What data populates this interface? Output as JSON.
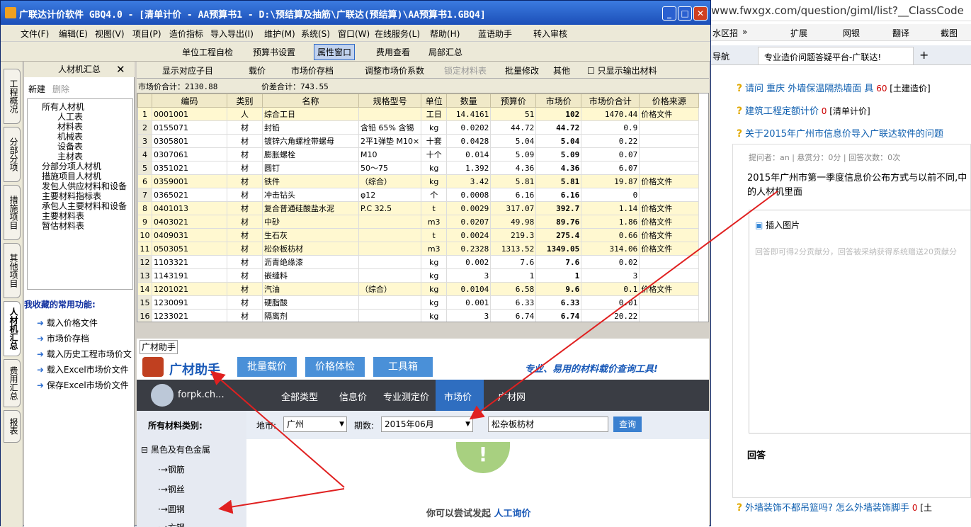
{
  "browser": {
    "url": "www.fwxgx.com/question/giml/list?__ClassCode",
    "tools": [
      "水区招",
      "»",
      "扩展",
      "网银",
      "翻译",
      "截图"
    ],
    "tabs": [
      "导航",
      "专业造价问题答疑平台-广联达!"
    ],
    "q1": "请问 重庆 外墙保温隔热墙面 具",
    "q1_pts": "60",
    "q1_tag": "[土建造价]",
    "q2": "建筑工程定额计价",
    "q2_pts": "0",
    "q2_tag": "[清单计价]",
    "q3": "关于2015年广州市信息价导入广联达软件的问题",
    "meta": "提问者：an  |  悬赏分：0分  |  回答次数：0次",
    "body": "2015年广州市第一季度信息价公布方式与以前不同,中的人材机里面",
    "insert_img": "插入图片",
    "placeholder": "回答即可得2分贡献分，回答被采纳获得系统赠送20贡献分",
    "answer": "回答",
    "q4": "外墙装饰不都吊篮吗? 怎么外墙装饰脚手",
    "q4_pts": "0",
    "q4_tag": "[土"
  },
  "title": "广联达计价软件 GBQ4.0 - [清单计价 - AA预算书1 - D:\\预结算及抽筋\\广联达(预结算)\\AA预算书1.GBQ4]",
  "menu": [
    "文件(F)",
    "编辑(E)",
    "视图(V)",
    "项目(P)",
    "造价指标",
    "导入导出(I)",
    "维护(M)",
    "系统(S)",
    "窗口(W)",
    "在线服务(L)",
    "帮助(H)",
    "蓝语助手",
    "转入审核"
  ],
  "toolbar": {
    "check": "单位工程自检",
    "setting": "预算书设置",
    "attr": "属性窗口",
    "fee": "费用查看",
    "local": "局部汇总"
  },
  "vtabs": [
    "工程概况",
    "分部分项",
    "措施项目",
    "其他项目",
    "人材机汇总",
    "费用汇总",
    "报表"
  ],
  "lpanel": {
    "title": "人材机汇总",
    "new": "新建",
    "del": "删除",
    "tree": [
      "所有人材机",
      "人工表",
      "材料表",
      "机械表",
      "设备表",
      "主材表",
      "分部分项人材机",
      "措施项目人材机",
      "发包人供应材料和设备",
      "主要材料指标表",
      "承包人主要材料和设备",
      "主要材料表",
      "暂估材料表"
    ],
    "fav_title": "我收藏的常用功能:",
    "favs": [
      "载入价格文件",
      "市场价存档",
      "载入历史工程市场价文",
      "载入Excel市场价文件",
      "保存Excel市场价文件"
    ]
  },
  "tbar2": [
    "显示对应子目",
    "载价",
    "市场价存档",
    "调整市场价系数",
    "锁定材料表",
    "批量修改",
    "其他",
    "只显示输出材料"
  ],
  "sum": {
    "market": "市场价合计：2130.88",
    "diff": "价差合计：743.55"
  },
  "grid": {
    "headers": [
      "",
      "编码",
      "类别",
      "名称",
      "规格型号",
      "单位",
      "数量",
      "预算价",
      "市场价",
      "市场价合计",
      "价格来源"
    ],
    "rows": [
      [
        "1",
        "0001001",
        "人",
        "综合工日",
        "",
        "工日",
        "14.4161",
        "51",
        "102",
        "1470.44",
        "价格文件"
      ],
      [
        "2",
        "0155071",
        "材",
        "封铅",
        "含铅 65% 含锡",
        "kg",
        "0.0202",
        "44.72",
        "44.72",
        "0.9",
        ""
      ],
      [
        "3",
        "0305801",
        "材",
        "镀锌六角螺栓带螺母",
        "2平1弹垫 M10×",
        "十套",
        "0.0428",
        "5.04",
        "5.04",
        "0.22",
        ""
      ],
      [
        "4",
        "0307061",
        "材",
        "膨胀螺栓",
        "M10",
        "十个",
        "0.014",
        "5.09",
        "5.09",
        "0.07",
        ""
      ],
      [
        "5",
        "0351021",
        "材",
        "圆钉",
        "50～75",
        "kg",
        "1.392",
        "4.36",
        "4.36",
        "6.07",
        ""
      ],
      [
        "6",
        "0359001",
        "材",
        "铁件",
        "（综合）",
        "kg",
        "3.42",
        "5.81",
        "5.81",
        "19.87",
        "价格文件"
      ],
      [
        "7",
        "0365021",
        "材",
        "冲击钻头",
        "φ12",
        "个",
        "0.0008",
        "6.16",
        "6.16",
        "0",
        ""
      ],
      [
        "8",
        "0401013",
        "材",
        "复合普通硅酸盐水泥",
        "P.C 32.5",
        "t",
        "0.0029",
        "317.07",
        "392.7",
        "1.14",
        "价格文件"
      ],
      [
        "9",
        "0403021",
        "材",
        "中砂",
        "",
        "m3",
        "0.0207",
        "49.98",
        "89.76",
        "1.86",
        "价格文件"
      ],
      [
        "10",
        "0409031",
        "材",
        "生石灰",
        "",
        "t",
        "0.0024",
        "219.3",
        "275.4",
        "0.66",
        "价格文件"
      ],
      [
        "11",
        "0503051",
        "材",
        "松杂板枋材",
        "",
        "m3",
        "0.2328",
        "1313.52",
        "1349.05",
        "314.06",
        "价格文件"
      ],
      [
        "12",
        "1103321",
        "材",
        "沥青绝缘漆",
        "",
        "kg",
        "0.002",
        "7.6",
        "7.6",
        "0.02",
        ""
      ],
      [
        "13",
        "1143191",
        "材",
        "嵌缝料",
        "",
        "kg",
        "3",
        "1",
        "1",
        "3",
        ""
      ],
      [
        "14",
        "1201021",
        "材",
        "汽油",
        "（综合）",
        "kg",
        "0.0104",
        "6.58",
        "9.6",
        "0.1",
        "价格文件"
      ],
      [
        "15",
        "1230091",
        "材",
        "硬脂酸",
        "",
        "kg",
        "0.001",
        "6.33",
        "6.33",
        "0.01",
        ""
      ],
      [
        "16",
        "1233021",
        "材",
        "隔离剂",
        "",
        "kg",
        "3",
        "6.74",
        "6.74",
        "20.22",
        ""
      ]
    ]
  },
  "asst": {
    "tab": "广材助手",
    "logo": "广材助手",
    "b1": "批量载价",
    "b2": "价格体检",
    "b3": "工具箱",
    "slogan": "专业、易用的材料载价查询工具!",
    "user": "forpk.ch...",
    "nav": [
      "全部类型",
      "信息价",
      "专业测定价",
      "市场价",
      "广材网"
    ],
    "cat_title": "所有材料类别:",
    "cats": [
      "黑色及有色金属",
      "钢筋",
      "钢丝",
      "圆钢",
      "方钢"
    ],
    "region_lbl": "地市:",
    "region": "广州",
    "period_lbl": "期数:",
    "period": "2015年06月",
    "query": "松杂板枋材",
    "search_btn": "查询",
    "tip": "你可以尝试发起",
    "tip_link": "人工询价"
  },
  "colors": {
    "arrow": "#e02020",
    "title": "#1c4fb8"
  }
}
